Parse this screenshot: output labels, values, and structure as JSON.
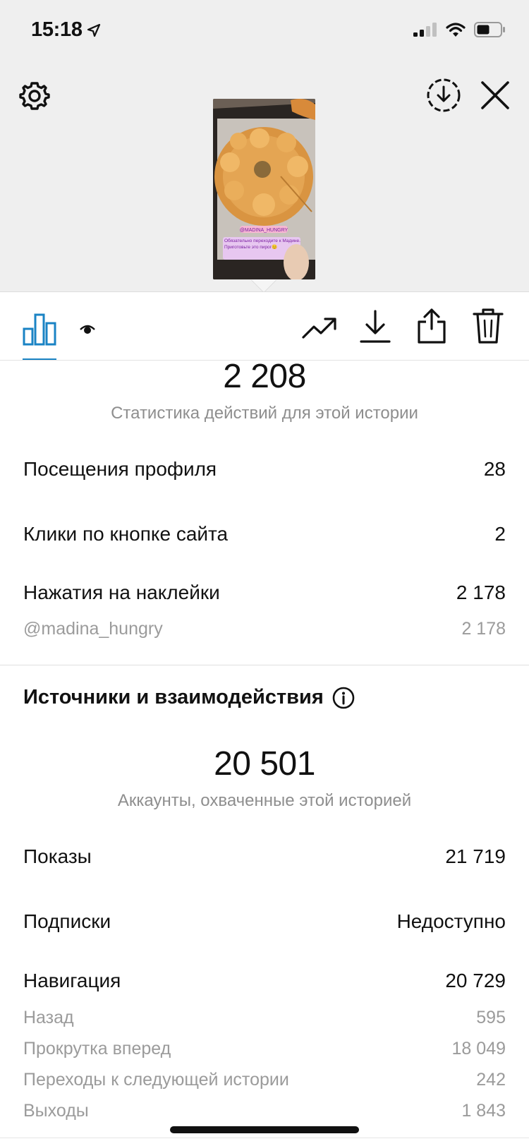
{
  "status_bar": {
    "time": "15:18"
  },
  "thumbnail": {
    "sticker_text": "@MADINA_HUNGRY",
    "caption": "Обязательно переходите к Мадине. Приготовьте это пирог😊"
  },
  "interactions": {
    "total": "2 208",
    "caption": "Статистика действий для этой истории",
    "rows": [
      {
        "label": "Посещения профиля",
        "value": "28"
      },
      {
        "label": "Клики по кнопке сайта",
        "value": "2"
      },
      {
        "label": "Нажатия на наклейки",
        "value": "2 178"
      }
    ],
    "sub_rows": [
      {
        "label": "@madina_hungry",
        "value": "2 178"
      }
    ]
  },
  "discovery": {
    "title": "Источники и взаимодействия",
    "total": "20 501",
    "caption": "Аккаунты, охваченные этой историей",
    "rows": [
      {
        "label": "Показы",
        "value": "21 719"
      },
      {
        "label": "Подписки",
        "value": "Недоступно"
      },
      {
        "label": "Навигация",
        "value": "20 729"
      }
    ],
    "sub_rows": [
      {
        "label": "Назад",
        "value": "595"
      },
      {
        "label": "Прокрутка вперед",
        "value": "18 049"
      },
      {
        "label": "Переходы к следующей истории",
        "value": "242"
      },
      {
        "label": "Выходы",
        "value": "1 843"
      }
    ]
  },
  "colors": {
    "accent": "#1a83c4",
    "muted": "#8e8e8e"
  }
}
